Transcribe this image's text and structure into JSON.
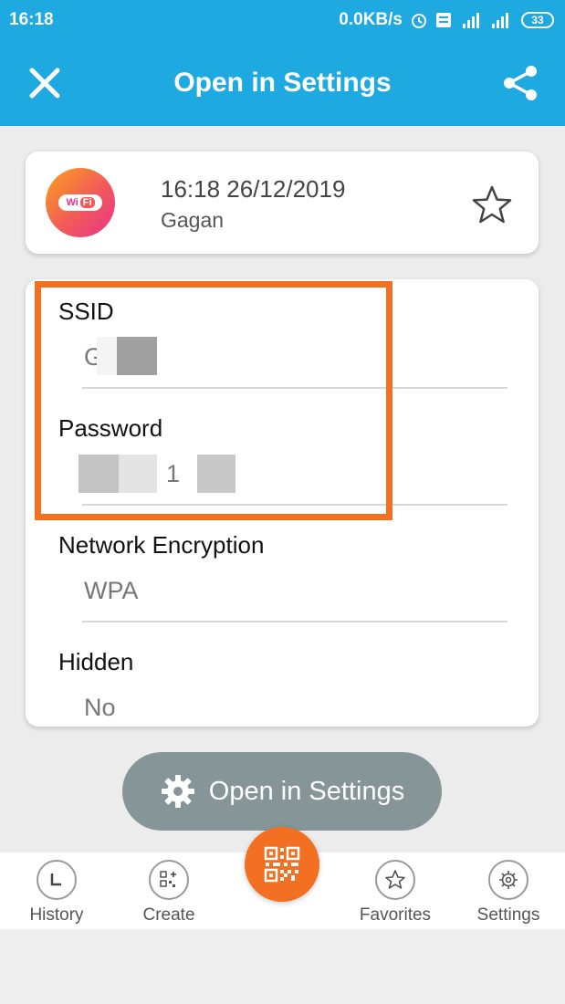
{
  "status_bar": {
    "time": "16:18",
    "network_speed": "0.0KB/s",
    "network_type": "4G",
    "battery": "33"
  },
  "app_bar": {
    "title": "Open in Settings",
    "close_icon": "close-icon",
    "share_icon": "share-icon"
  },
  "header": {
    "datetime": "16:18 26/12/2019",
    "name": "Gagan",
    "logo_text_wi": "Wi",
    "logo_text_fi": "Fi"
  },
  "fields": [
    {
      "label": "SSID",
      "value": "G"
    },
    {
      "label": "Password",
      "value": "1"
    },
    {
      "label": "Network Encryption",
      "value": "WPA"
    },
    {
      "label": "Hidden",
      "value": "No"
    }
  ],
  "action_button": {
    "label": "Open in Settings",
    "icon": "gear-icon"
  },
  "bottom_nav": {
    "items": [
      {
        "label": "History",
        "icon": "clock-icon"
      },
      {
        "label": "Create",
        "icon": "qr-add-icon"
      },
      {
        "label": "Favorites",
        "icon": "star-icon"
      },
      {
        "label": "Settings",
        "icon": "gear-icon"
      }
    ],
    "center_icon": "qr-scan-icon"
  },
  "colors": {
    "primary": "#1fa9e1",
    "accent": "#f36f21",
    "button": "#869598"
  }
}
